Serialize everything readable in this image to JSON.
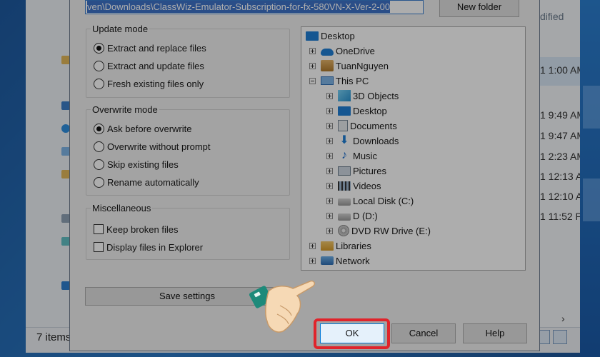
{
  "background": {
    "status_text": "7 items",
    "time_column_header": "dified",
    "row_times": [
      "1 1:00 AM",
      "1 9:49 AM",
      "1 9:47 AM",
      "1 2:23 AM",
      "1 12:13 A",
      "1 12:10 A",
      "1 11:52 P"
    ]
  },
  "dialog": {
    "path_value": "ven\\Downloads\\ClassWiz-Emulator-Subscription-for-fx-580VN-X-Ver-2-00",
    "new_folder_label": "New folder",
    "update_mode": {
      "legend": "Update mode",
      "options": [
        "Extract and replace files",
        "Extract and update files",
        "Fresh existing files only"
      ],
      "selected": "Extract and replace files"
    },
    "overwrite_mode": {
      "legend": "Overwrite mode",
      "options": [
        "Ask before overwrite",
        "Overwrite without prompt",
        "Skip existing files",
        "Rename automatically"
      ],
      "selected": "Ask before overwrite"
    },
    "miscellaneous": {
      "legend": "Miscellaneous",
      "options": [
        "Keep broken files",
        "Display files in Explorer"
      ]
    },
    "save_settings_label": "Save settings",
    "tree": [
      {
        "label": "Desktop",
        "icon": "desktop-icon",
        "level": 0
      },
      {
        "label": "OneDrive",
        "icon": "onedrive-icon",
        "level": 1
      },
      {
        "label": "TuanNguyen",
        "icon": "user-folder-icon",
        "level": 1
      },
      {
        "label": "This PC",
        "icon": "this-pc-icon",
        "level": 1
      },
      {
        "label": "3D Objects",
        "icon": "3d-objects-icon",
        "level": 2
      },
      {
        "label": "Desktop",
        "icon": "desktop-icon",
        "level": 2
      },
      {
        "label": "Documents",
        "icon": "documents-icon",
        "level": 2
      },
      {
        "label": "Downloads",
        "icon": "downloads-icon",
        "level": 2
      },
      {
        "label": "Music",
        "icon": "music-icon",
        "level": 2
      },
      {
        "label": "Pictures",
        "icon": "pictures-icon",
        "level": 2
      },
      {
        "label": "Videos",
        "icon": "videos-icon",
        "level": 2
      },
      {
        "label": "Local Disk (C:)",
        "icon": "local-disk-icon",
        "level": 2
      },
      {
        "label": "D (D:)",
        "icon": "drive-icon",
        "level": 2
      },
      {
        "label": "DVD RW Drive (E:)",
        "icon": "dvd-drive-icon",
        "level": 2
      },
      {
        "label": "Libraries",
        "icon": "libraries-icon",
        "level": 1
      },
      {
        "label": "Network",
        "icon": "network-icon",
        "level": 1
      }
    ],
    "ok_label": "OK",
    "cancel_label": "Cancel",
    "help_label": "Help"
  },
  "colors": {
    "highlight_border": "#e0242b",
    "selection_blue": "#3f74c9",
    "hand_cuff": "#1d8a7a"
  }
}
